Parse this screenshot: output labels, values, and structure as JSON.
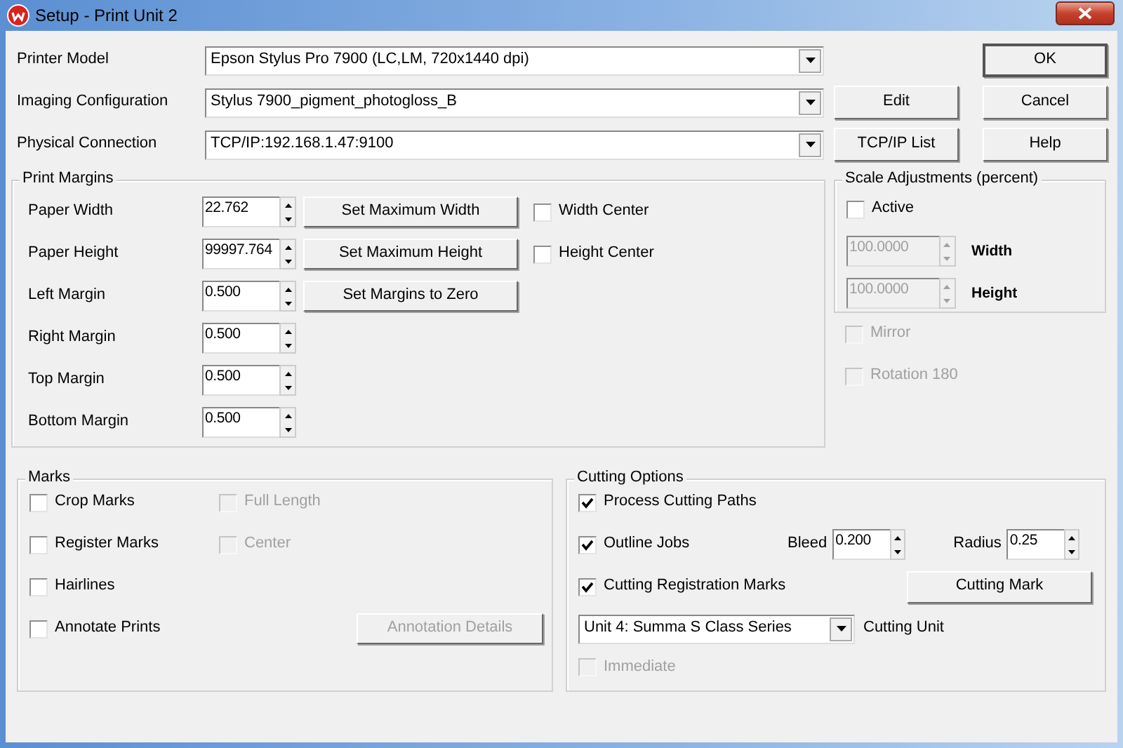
{
  "window": {
    "title": "Setup - Print Unit 2"
  },
  "settings": [
    {
      "label": "Printer Model",
      "value": "Epson  Stylus Pro 7900  (LC,LM, 720x1440 dpi)"
    },
    {
      "label": "Imaging Configuration",
      "value": "Stylus 7900_pigment_photogloss_B",
      "button": "Edit"
    },
    {
      "label": "Physical Connection",
      "value": "TCP/IP:192.168.1.47:9100",
      "button": "TCP/IP List"
    }
  ],
  "dialog_buttons": [
    {
      "label": "OK",
      "default": true
    },
    {
      "label": "Cancel",
      "default": false
    },
    {
      "label": "Help",
      "default": false
    }
  ],
  "print_margins": {
    "title": "Print Margins",
    "rows": [
      {
        "label": "Paper Width",
        "value": "22.762",
        "button": "Set Maximum Width",
        "checkbox": {
          "label": "Width Center",
          "checked": false
        }
      },
      {
        "label": "Paper Height",
        "value": "99997.764",
        "button": "Set Maximum Height",
        "checkbox": {
          "label": "Height Center",
          "checked": false
        }
      },
      {
        "label": "Left Margin",
        "value": "0.500",
        "button": "Set Margins to Zero"
      },
      {
        "label": "Right Margin",
        "value": "0.500"
      },
      {
        "label": "Top Margin",
        "value": "0.500"
      },
      {
        "label": "Bottom Margin",
        "value": "0.500"
      }
    ]
  },
  "scale_adjustments": {
    "title": "Scale Adjustments (percent)",
    "active": {
      "label": "Active",
      "checked": false,
      "disabled": false
    },
    "fields": [
      {
        "value": "100.0000",
        "label": "Width",
        "disabled": true
      },
      {
        "value": "100.0000",
        "label": "Height",
        "disabled": true
      }
    ]
  },
  "options": [
    {
      "label": "Mirror",
      "checked": false,
      "disabled": true
    },
    {
      "label": "Rotation  180",
      "checked": false,
      "disabled": true
    }
  ],
  "marks": {
    "title": "Marks",
    "rows": [
      {
        "items": [
          {
            "kind": "checkbox",
            "label": "Crop Marks",
            "checked": false,
            "disabled": false
          },
          {
            "kind": "checkbox",
            "label": "Full Length",
            "checked": false,
            "disabled": true
          }
        ]
      },
      {
        "items": [
          {
            "kind": "checkbox",
            "label": "Register Marks",
            "checked": false,
            "disabled": false
          },
          {
            "kind": "checkbox",
            "label": "Center",
            "checked": false,
            "disabled": true
          }
        ]
      },
      {
        "items": [
          {
            "kind": "checkbox",
            "label": "Hairlines",
            "checked": false,
            "disabled": false
          }
        ]
      },
      {
        "items": [
          {
            "kind": "checkbox",
            "label": "Annotate Prints",
            "checked": false,
            "disabled": false
          },
          {
            "kind": "button",
            "label": "Annotation Details",
            "disabled": true
          }
        ]
      }
    ]
  },
  "cutting_options": {
    "title": "Cutting Options",
    "rows": [
      {
        "items": [
          {
            "kind": "checkbox",
            "label": "Process Cutting Paths",
            "checked": true,
            "disabled": false
          }
        ]
      },
      {
        "items": [
          {
            "kind": "checkbox",
            "label": "Outline Jobs",
            "checked": true,
            "disabled": false
          },
          {
            "kind": "text",
            "label": "Bleed"
          },
          {
            "kind": "spinner",
            "value": "0.200",
            "disabled": false
          },
          {
            "kind": "text",
            "label": "Radius"
          },
          {
            "kind": "spinner",
            "value": "0.25",
            "disabled": false
          }
        ]
      },
      {
        "items": [
          {
            "kind": "checkbox",
            "label": "Cutting Registration Marks",
            "checked": true,
            "disabled": false
          },
          {
            "kind": "button",
            "label": "Cutting Mark",
            "disabled": false
          }
        ]
      },
      {
        "items": [
          {
            "kind": "combo",
            "value": "Unit 4: Summa  S Class Series"
          },
          {
            "kind": "text",
            "label": "Cutting Unit"
          }
        ]
      },
      {
        "items": [
          {
            "kind": "checkbox",
            "label": "Immediate",
            "checked": false,
            "disabled": true
          }
        ]
      }
    ]
  }
}
